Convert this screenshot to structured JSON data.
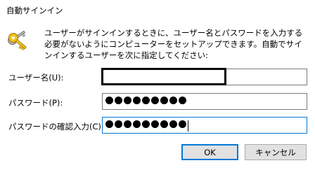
{
  "window": {
    "title": "自動サインイン"
  },
  "description": "ユーザーがサインインするときに、ユーザー名とパスワードを入力する必要がないようにコンピューターをセットアップできます。自動でサインインするユーザーを次に指定してください:",
  "form": {
    "username": {
      "label": "ユーザー名(U):",
      "value": ""
    },
    "password": {
      "label": "パスワード(P):",
      "masked_length": 9
    },
    "confirm_password": {
      "label": "パスワードの確認入力(C):",
      "masked_length": 9
    }
  },
  "buttons": {
    "ok_label": "OK",
    "cancel_label": "キャンセル"
  },
  "icons": {
    "header": "keys-icon"
  },
  "colors": {
    "focus_border": "#0078d7",
    "button_face": "#e1e1e1"
  }
}
